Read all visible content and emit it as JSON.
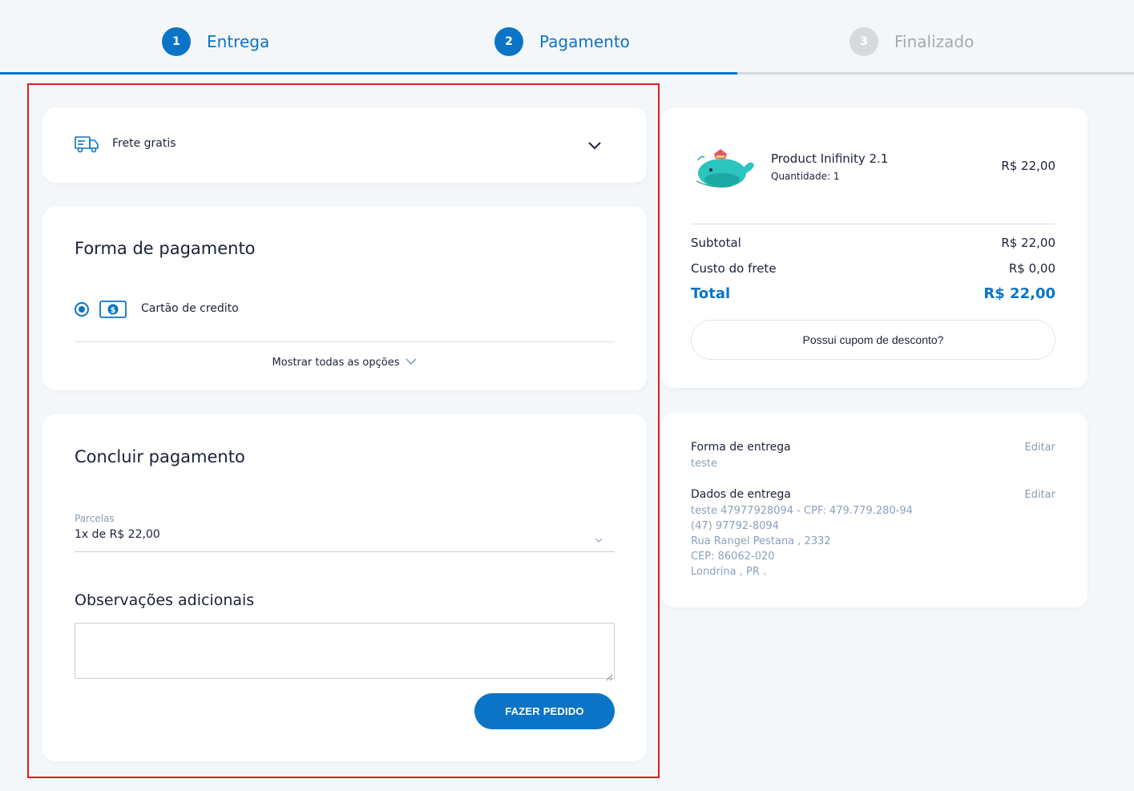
{
  "stepper": {
    "steps": [
      {
        "number": "1",
        "label": "Entrega",
        "state": "active"
      },
      {
        "number": "2",
        "label": "Pagamento",
        "state": "active"
      },
      {
        "number": "3",
        "label": "Finalizado",
        "state": "inactive"
      }
    ],
    "progress_percent": 65
  },
  "colors": {
    "primary": "#0b74c7",
    "highlight": "#e3191f",
    "muted": "#8a9bb0"
  },
  "shipping": {
    "icon": "truck-icon",
    "label": "Frete gratis"
  },
  "payment_method": {
    "title": "Forma de pagamento",
    "selected_option": "Cartão de credito",
    "option_icon": "cash-icon",
    "show_all_label": "Mostrar todas as opções"
  },
  "checkout": {
    "title": "Concluir pagamento",
    "installments_label": "Parcelas",
    "installments_value": "1x de R$ 22,00",
    "notes_title": "Observações adicionais",
    "notes_value": "",
    "submit_label": "FAZER PEDIDO"
  },
  "summary": {
    "product_name": "Product Inifinity 2.1",
    "product_qty": "Quantidade: 1",
    "product_price": "R$ 22,00",
    "subtotal_label": "Subtotal",
    "subtotal_value": "R$ 22,00",
    "shipping_label": "Custo do frete",
    "shipping_value": "R$ 0,00",
    "total_label": "Total",
    "total_value": "R$ 22,00",
    "coupon_label": "Possui cupom de desconto?"
  },
  "delivery": {
    "method_title": "Forma de entrega",
    "method_value": "teste",
    "method_edit": "Editar",
    "data_title": "Dados de entrega",
    "data_edit": "Editar",
    "data_lines": [
      "teste 47977928094 - CPF: 479.779.280-94",
      "(47) 97792-8094",
      "Rua Rangel Pestana , 2332",
      "CEP: 86062-020",
      "Londrina , PR ."
    ]
  }
}
